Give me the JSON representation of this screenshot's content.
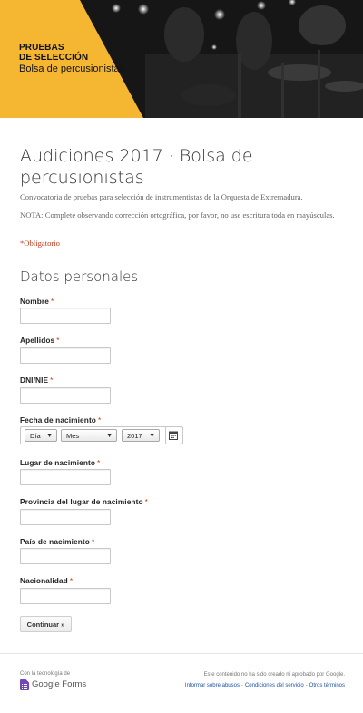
{
  "banner": {
    "line1": "PRUEBAS",
    "line2": "DE SELECCIÓN",
    "line3": "Bolsa de percusionistas",
    "accent_color": "#f5b731"
  },
  "form": {
    "title": "Audiciones 2017 · Bolsa de percusionistas",
    "description": "Convocatoria de pruebas para selección de instrumentistas de la Orquesta de Extremadura.",
    "note": "NOTA: Complete observando corrección ortográfica, por favor, no use escritura toda en mayúsculas.",
    "required_note": "*Obligatorio",
    "section_title": "Datos personales",
    "fields": [
      {
        "label": "Nombre",
        "required": "*"
      },
      {
        "label": "Apellidos",
        "required": "*"
      },
      {
        "label": "DNI/NIE",
        "required": "*"
      },
      {
        "label": "Fecha de nacimiento",
        "required": "*"
      },
      {
        "label": "Lugar de nacimiento",
        "required": "*"
      },
      {
        "label": "Provincia del lugar de nacimiento",
        "required": "*"
      },
      {
        "label": "País de nacimiento",
        "required": "*"
      },
      {
        "label": "Nacionalidad",
        "required": "*"
      }
    ],
    "date": {
      "day": "Día",
      "month": "Mes",
      "year": "2017",
      "chevron": "▼",
      "calendar_icon": "calendar-icon"
    },
    "continue_label": "Continuar »"
  },
  "footer": {
    "powered_by": "Con la tecnología de",
    "brand": "Google Forms",
    "disclaimer": "Este contenido no ha sido creado ni aprobado por Google.",
    "links": [
      "Informar sobre abusos",
      "Condiciones del servicio",
      "Otros términos"
    ],
    "separator": "-"
  },
  "colors": {
    "required": "#c43b1d",
    "link": "#1c52a8",
    "brand_purple": "#7248b9"
  }
}
